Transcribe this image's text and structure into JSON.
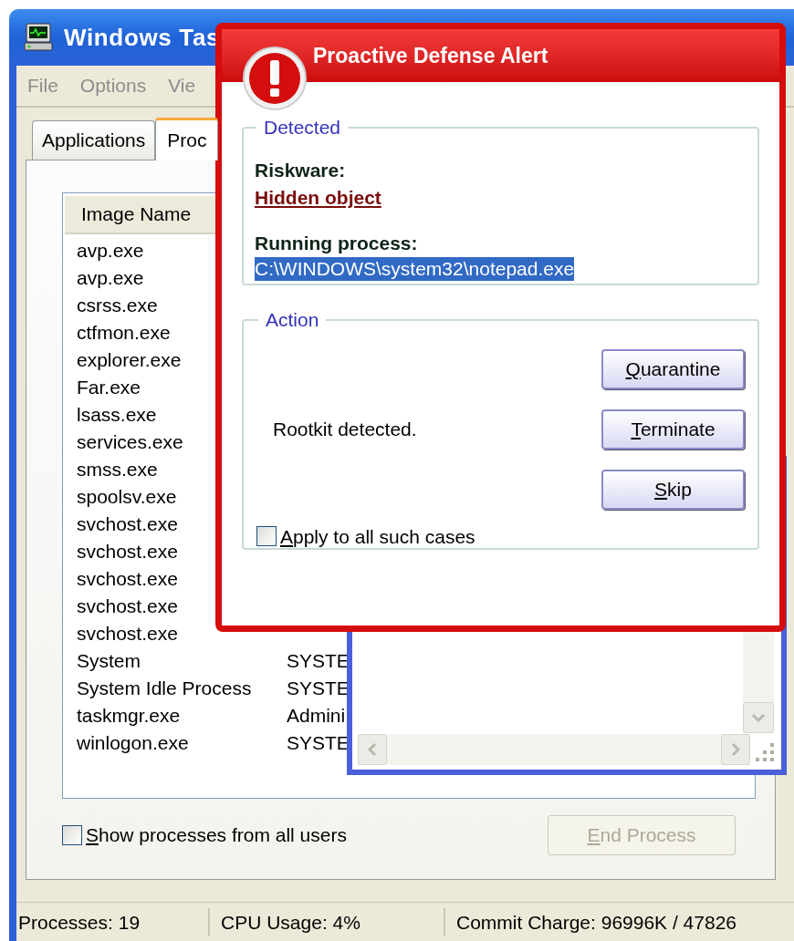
{
  "task_manager": {
    "title": "Windows Tas",
    "menu": [
      "File",
      "Options",
      "Vie"
    ],
    "tabs": [
      {
        "label": "Applications",
        "selected": false
      },
      {
        "label": "Proc",
        "selected": true
      }
    ],
    "columns": [
      "Image Name"
    ],
    "processes": [
      {
        "name": "avp.exe"
      },
      {
        "name": "avp.exe"
      },
      {
        "name": "csrss.exe"
      },
      {
        "name": "ctfmon.exe"
      },
      {
        "name": "explorer.exe"
      },
      {
        "name": "Far.exe"
      },
      {
        "name": "lsass.exe"
      },
      {
        "name": "services.exe"
      },
      {
        "name": "smss.exe"
      },
      {
        "name": "spoolsv.exe"
      },
      {
        "name": "svchost.exe"
      },
      {
        "name": "svchost.exe"
      },
      {
        "name": "svchost.exe"
      },
      {
        "name": "svchost.exe"
      },
      {
        "name": "svchost.exe"
      },
      {
        "name": "System",
        "user": "SYSTE"
      },
      {
        "name": "System Idle Process",
        "user": "SYSTE"
      },
      {
        "name": "taskmgr.exe",
        "user": "Admini"
      },
      {
        "name": "winlogon.exe",
        "user": "SYSTE"
      }
    ],
    "show_all_users": {
      "label": "Show processes from all users",
      "checked": false
    },
    "end_process": {
      "label": "End Process",
      "disabled": true
    },
    "status_bar": [
      "Processes: 19",
      "CPU Usage: 4%",
      "Commit Charge: 96996K / 47826"
    ]
  },
  "alert": {
    "title": "Proactive Defense Alert",
    "detected": {
      "legend": "Detected",
      "riskware_label": "Riskware:",
      "riskware": "Hidden object",
      "process_label": "Running process:",
      "process_path": "C:\\WINDOWS\\system32\\notepad.exe",
      "path_selected": true
    },
    "action": {
      "legend": "Action",
      "message": "Rootkit detected.",
      "buttons": [
        "Quarantine",
        "Terminate",
        "Skip"
      ],
      "apply_all": {
        "label": "Apply to all such cases",
        "checked": false
      }
    }
  }
}
